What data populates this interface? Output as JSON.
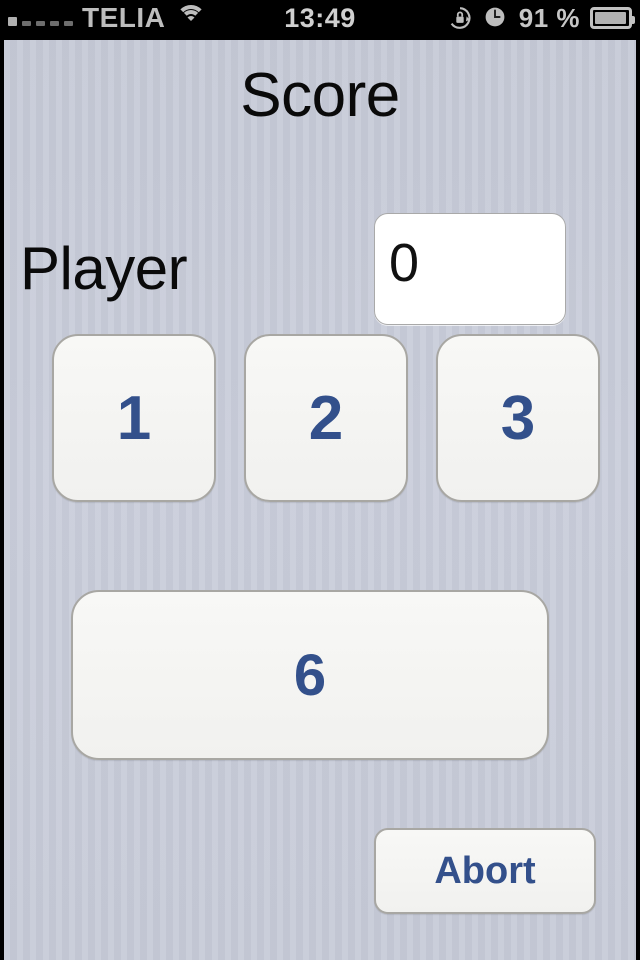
{
  "status_bar": {
    "signal_icon": "signal-strength-icon",
    "signal_bars_filled": 1,
    "signal_bars_total": 5,
    "carrier": "TELIA",
    "wifi_icon": "wifi-icon",
    "time": "13:49",
    "rotation_lock_icon": "rotation-lock-icon",
    "alarm_icon": "alarm-clock-icon",
    "battery_percent": "91 %",
    "battery_icon": "battery-icon"
  },
  "screen": {
    "title": "Score",
    "player": {
      "label": "Player",
      "score_value": "0",
      "score_placeholder": "0"
    },
    "number_buttons": [
      {
        "label": "1",
        "name": "score-button-1"
      },
      {
        "label": "2",
        "name": "score-button-2"
      },
      {
        "label": "3",
        "name": "score-button-3"
      }
    ],
    "wide_button": {
      "label": "6",
      "name": "score-button-6"
    },
    "abort_button": {
      "label": "Abort",
      "name": "abort-button"
    }
  },
  "colors": {
    "accent_blue": "#33508b",
    "background": "#c9cdd9",
    "button_face": "#f4f4f2",
    "button_border": "#a8a7a3",
    "status_bar_bg": "#000000",
    "status_bar_text": "#bdbdbd"
  }
}
